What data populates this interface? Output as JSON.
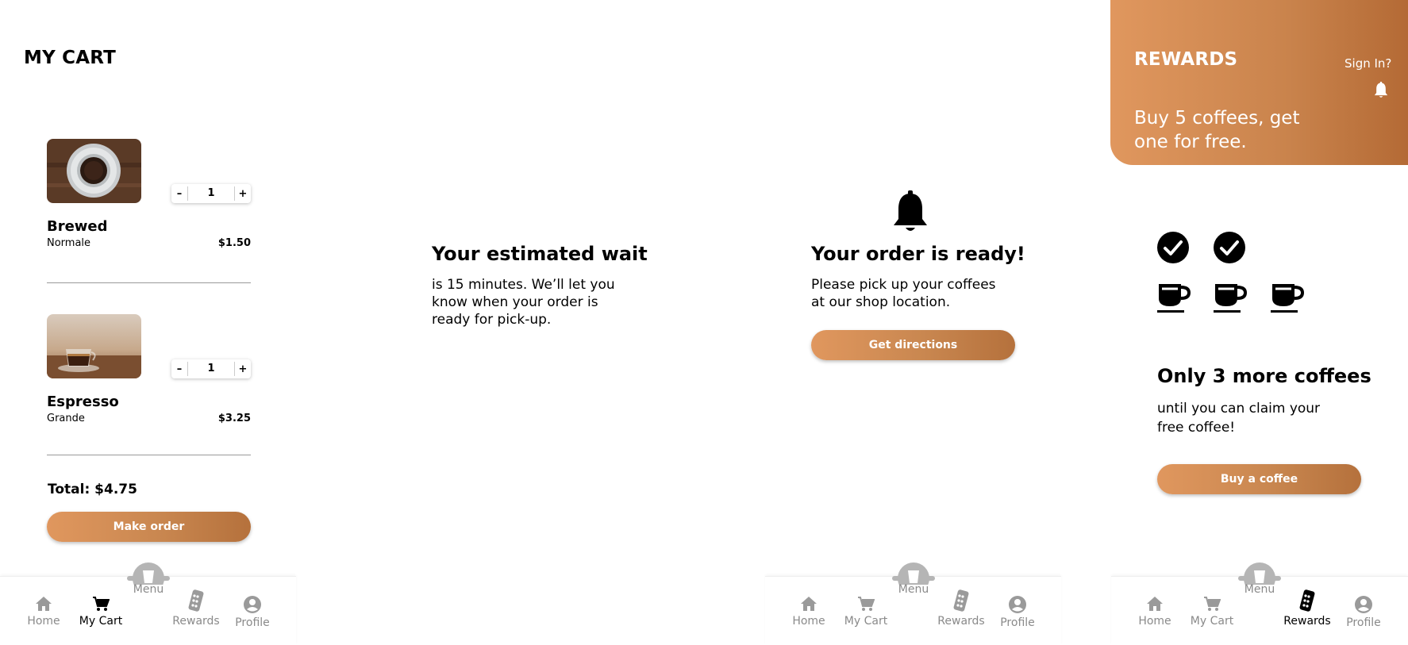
{
  "cart": {
    "title": "MY CART",
    "items": [
      {
        "name": "Brewed",
        "size": "Normale",
        "price": "$1.50",
        "qty": "1",
        "image": "coffee-cup-top-view-image"
      },
      {
        "name": "Espresso",
        "size": "Grande",
        "price": "$3.25",
        "qty": "1",
        "image": "espresso-glass-image"
      }
    ],
    "stepper": {
      "minus": "–",
      "plus": "+"
    },
    "total": "Total: $4.75",
    "make_order": "Make order"
  },
  "wait": {
    "title": "Your estimated wait",
    "body": "is 15 minutes. We’ll let you know when your order is ready for pick-up."
  },
  "ready": {
    "icon": "bell-icon",
    "title": "Your order is ready!",
    "body": "Please pick up your coffees at our shop location.",
    "button": "Get directions"
  },
  "rewards": {
    "title": "REWARDS",
    "sign_in": "Sign In?",
    "promo": "Buy 5 coffees, get one for free.",
    "checks": 2,
    "cups": 3,
    "heading": "Only 3 more coffees",
    "body": "until you can claim your free coffee!",
    "button": "Buy a coffee"
  },
  "nav": {
    "menu": "Menu",
    "home": "Home",
    "cart": "My Cart",
    "rewards": "Rewards",
    "profile": "Profile"
  },
  "colors": {
    "accent_start": "#e0975e",
    "accent_end": "#b5713c",
    "nav_inactive": "#8a8a8a"
  }
}
